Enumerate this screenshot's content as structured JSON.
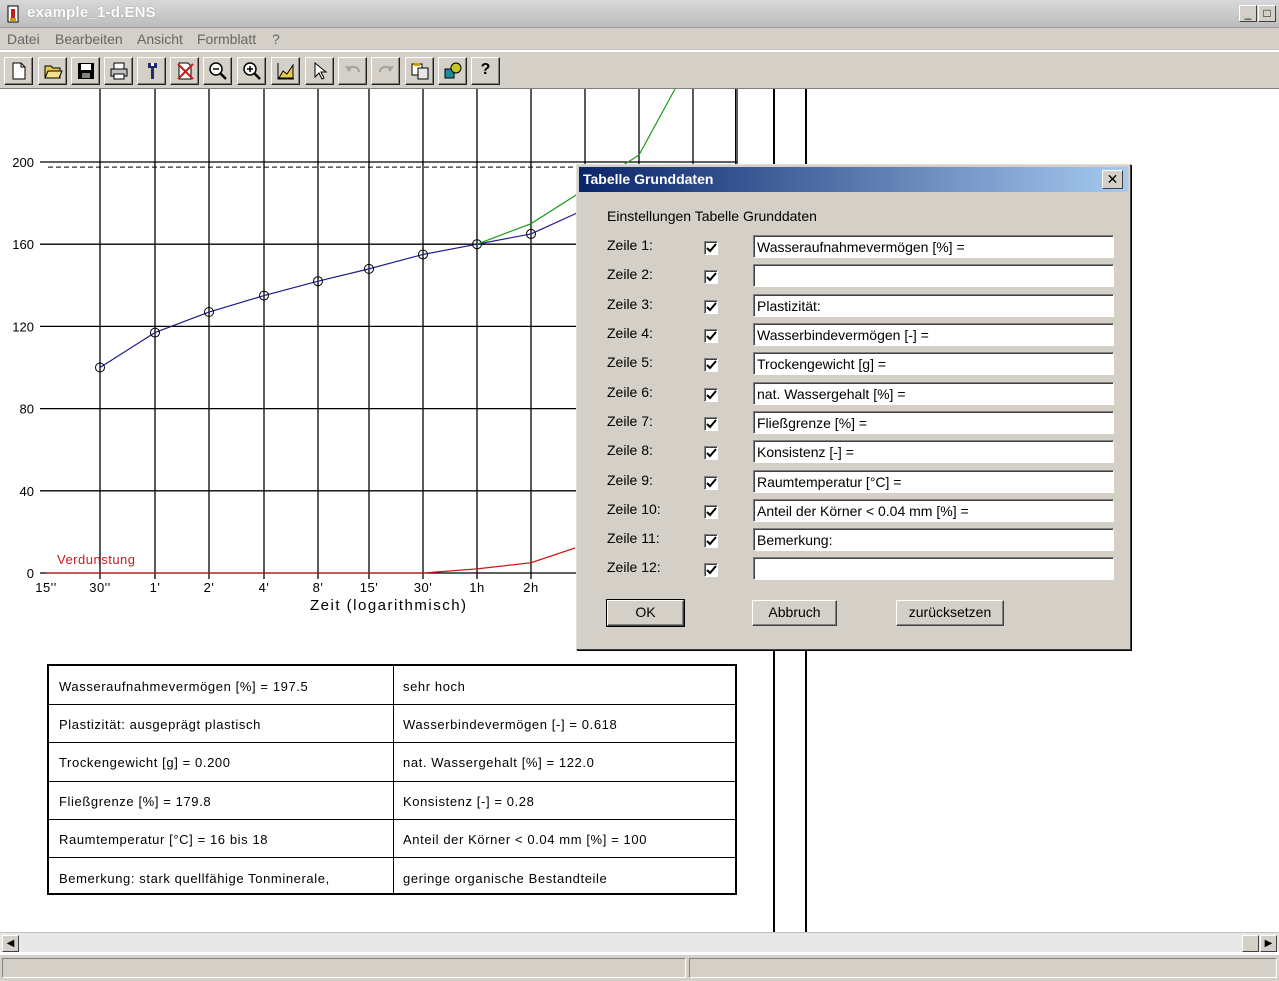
{
  "window": {
    "title": "example_1-d.ENS"
  },
  "menu": [
    "Datei",
    "Bearbeiten",
    "Ansicht",
    "Formblatt",
    "?"
  ],
  "toolbar": {
    "help_label": "?"
  },
  "chart_data": {
    "type": "line",
    "xlabel": "Zeit (logarithmisch)",
    "x_ticks": [
      "15''",
      "30''",
      "1'",
      "2'",
      "4'",
      "8'",
      "15'",
      "30'",
      "1h",
      "2h"
    ],
    "y_ticks": [
      "0",
      "40",
      "80",
      "120",
      "160",
      "200"
    ],
    "ylim": [
      0,
      200
    ],
    "grid": true,
    "reference_line_y": 197.5,
    "evaporation_label": "Verdunstung",
    "series": [
      {
        "color": "#1c1c8c",
        "x": [
          "30''",
          "1'",
          "2'",
          "4'",
          "8'",
          "15'",
          "30'",
          "1h",
          "2h"
        ],
        "values": [
          100,
          117,
          127,
          135,
          142,
          148,
          155,
          160,
          165
        ]
      },
      {
        "color": "#1a9a1a",
        "x": [
          "1h",
          "2h"
        ],
        "values": [
          160,
          170
        ]
      },
      {
        "color": "#cc1a1a",
        "x": [
          "15''",
          "30''",
          "1'",
          "2'",
          "4'",
          "8'",
          "15'",
          "30'",
          "1h",
          "2h"
        ],
        "values": [
          0,
          0,
          0,
          0,
          0,
          0,
          0,
          0,
          2,
          5
        ]
      }
    ]
  },
  "table": {
    "rows": [
      [
        "Wasseraufnahmevermögen [%] =  197.5",
        "sehr hoch"
      ],
      [
        "Plastizität:  ausgeprägt plastisch",
        "Wasserbindevermögen [-] =  0.618"
      ],
      [
        "Trockengewicht [g] =  0.200",
        "nat. Wassergehalt [%] =  122.0"
      ],
      [
        "Fließgrenze [%] =  179.8",
        "Konsistenz [-] =  0.28"
      ],
      [
        "Raumtemperatur [°C] =  16 bis 18",
        "Anteil der Körner < 0.04 mm [%] =  100"
      ],
      [
        "Bemerkung:  stark quellfähige Tonminerale,",
        "geringe organische Bestandteile"
      ]
    ]
  },
  "dialog": {
    "title": "Tabelle Grunddaten",
    "close": "✕",
    "heading": "Einstellungen Tabelle Grunddaten",
    "rows": [
      {
        "label": "Zeile 1:",
        "checked": true,
        "value": "Wasseraufnahmevermögen [%] ="
      },
      {
        "label": "Zeile 2:",
        "checked": true,
        "value": ""
      },
      {
        "label": "Zeile 3:",
        "checked": true,
        "value": "Plastizität:"
      },
      {
        "label": "Zeile 4:",
        "checked": true,
        "value": "Wasserbindevermögen [-] ="
      },
      {
        "label": "Zeile 5:",
        "checked": true,
        "value": "Trockengewicht [g] ="
      },
      {
        "label": "Zeile 6:",
        "checked": true,
        "value": "nat. Wassergehalt [%] ="
      },
      {
        "label": "Zeile 7:",
        "checked": true,
        "value": "Fließgrenze [%] ="
      },
      {
        "label": "Zeile 8:",
        "checked": true,
        "value": "Konsistenz [-] ="
      },
      {
        "label": "Zeile 9:",
        "checked": true,
        "value": "Raumtemperatur [°C] ="
      },
      {
        "label": "Zeile 10:",
        "checked": true,
        "value": "Anteil der Körner < 0.04 mm [%] ="
      },
      {
        "label": "Zeile 11:",
        "checked": true,
        "value": "Bemerkung:"
      },
      {
        "label": "Zeile 12:",
        "checked": true,
        "value": ""
      }
    ],
    "buttons": {
      "ok": "OK",
      "cancel": "Abbruch",
      "reset": "zurücksetzen"
    }
  }
}
